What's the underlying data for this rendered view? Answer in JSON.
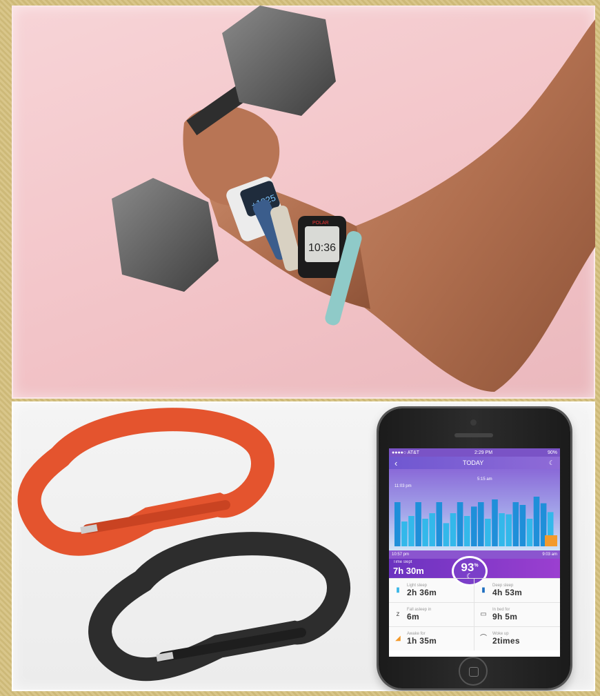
{
  "top_photo": {
    "watch1_display": "+1825",
    "watch2_display": "10:36",
    "watch2_brand": "POLAR"
  },
  "phone": {
    "status": {
      "carrier": "●●●●○ AT&T",
      "time": "2:29 PM",
      "battery": "90%"
    },
    "nav": {
      "back": "‹",
      "title": "TODAY",
      "moon": "☾"
    },
    "graph": {
      "start_marker": "11:03 pm",
      "end_marker": "5:15 am",
      "bed_time": "10:57 pm",
      "wake_time": "9:03 am",
      "bars": [
        0.8,
        0.45,
        0.55,
        0.8,
        0.5,
        0.6,
        0.8,
        0.42,
        0.6,
        0.8,
        0.55,
        0.72,
        0.8,
        0.5,
        0.85,
        0.6,
        0.58,
        0.8,
        0.75,
        0.5,
        0.9,
        0.78,
        0.62
      ]
    },
    "summary": {
      "label": "Time slept",
      "value": "7h 30m",
      "quality": "93",
      "quality_unit": "%"
    },
    "stats": [
      {
        "icon": "light-sleep-icon",
        "label": "Light sleep",
        "value": "2h 36m"
      },
      {
        "icon": "deep-sleep-icon",
        "label": "Deep sleep",
        "value": "4h 53m"
      },
      {
        "icon": "fall-asleep-icon",
        "label": "Fall asleep in",
        "value": "6m"
      },
      {
        "icon": "in-bed-icon",
        "label": "In bed for",
        "value": "9h 5m"
      },
      {
        "icon": "awake-icon",
        "label": "Awake for",
        "value": "1h 35m"
      },
      {
        "icon": "woke-up-icon",
        "label": "Woke up",
        "value": "2times"
      }
    ]
  }
}
